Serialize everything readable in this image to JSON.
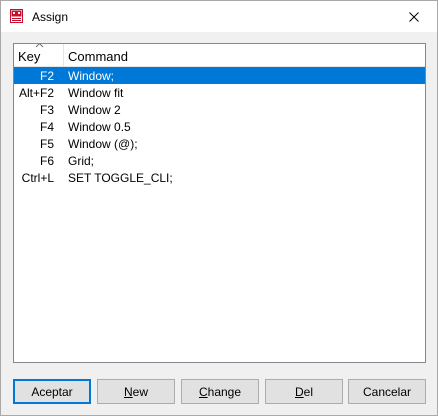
{
  "window": {
    "title": "Assign"
  },
  "list": {
    "headers": {
      "key": "Key",
      "command": "Command"
    },
    "rows": [
      {
        "key": "F2",
        "command": "Window;",
        "selected": true
      },
      {
        "key": "Alt+F2",
        "command": "Window fit",
        "selected": false
      },
      {
        "key": "F3",
        "command": "Window 2",
        "selected": false
      },
      {
        "key": "F4",
        "command": "Window 0.5",
        "selected": false
      },
      {
        "key": "F5",
        "command": "Window (@);",
        "selected": false
      },
      {
        "key": "F6",
        "command": "Grid;",
        "selected": false
      },
      {
        "key": "Ctrl+L",
        "command": "SET TOGGLE_CLI;",
        "selected": false
      }
    ]
  },
  "buttons": {
    "accept": "Aceptar",
    "new": {
      "mnemonic": "N",
      "rest": "ew"
    },
    "change": {
      "mnemonic": "C",
      "rest": "hange"
    },
    "del": {
      "mnemonic": "D",
      "rest": "el"
    },
    "cancel": "Cancelar"
  },
  "colors": {
    "selection": "#0078d7",
    "default_button_border": "#0078d7",
    "app_icon": "#c8102e"
  },
  "icons": {
    "app": "app-logo-icon",
    "close": "close-icon",
    "sort": "sort-ascending-icon"
  }
}
